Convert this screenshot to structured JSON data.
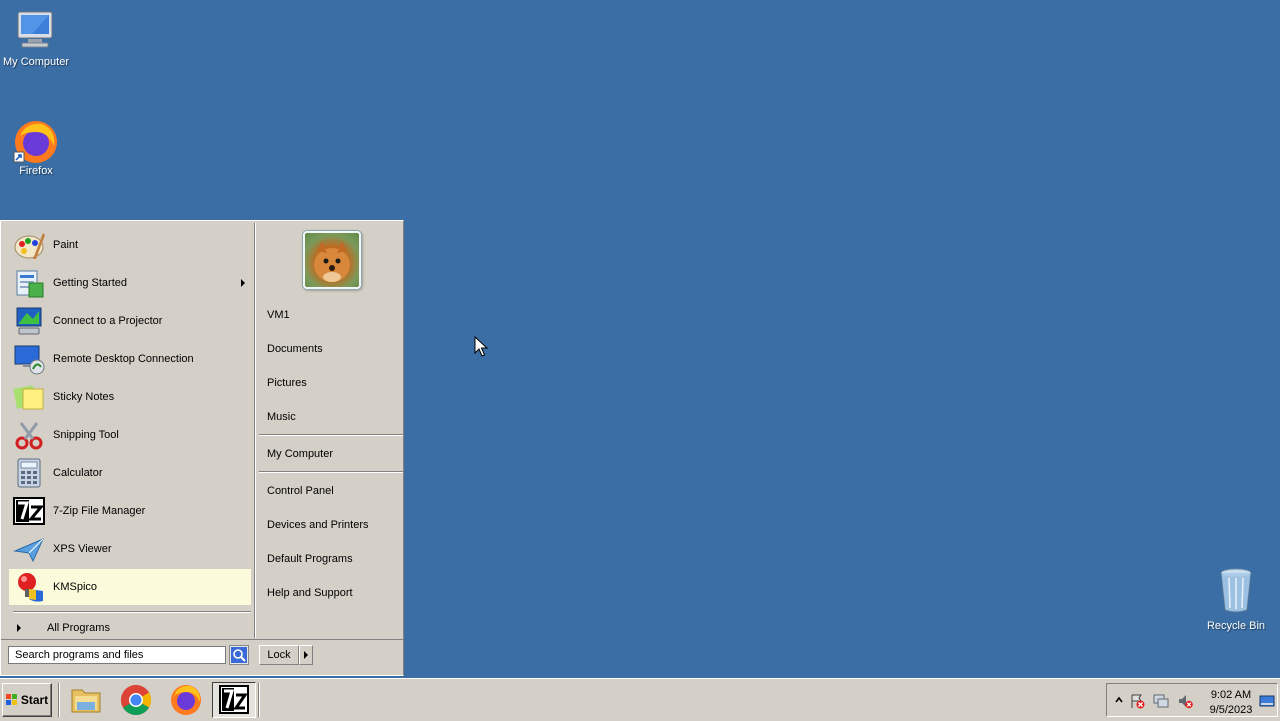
{
  "desktop": {
    "icons": [
      {
        "label": "My Computer",
        "icon": "computer-icon"
      },
      {
        "label": "Firefox",
        "icon": "firefox-icon"
      },
      {
        "label": "Recycle Bin",
        "icon": "recycle-bin-icon"
      }
    ]
  },
  "start_menu": {
    "programs": [
      {
        "label": "Paint",
        "icon": "paint-icon"
      },
      {
        "label": "Getting Started",
        "icon": "getting-started-icon",
        "has_submenu": true
      },
      {
        "label": "Connect to a Projector",
        "icon": "projector-icon"
      },
      {
        "label": "Remote Desktop Connection",
        "icon": "remote-desktop-icon"
      },
      {
        "label": "Sticky Notes",
        "icon": "sticky-notes-icon"
      },
      {
        "label": "Snipping Tool",
        "icon": "snipping-tool-icon"
      },
      {
        "label": "Calculator",
        "icon": "calculator-icon"
      },
      {
        "label": "7-Zip File Manager",
        "icon": "7zip-icon"
      },
      {
        "label": "XPS Viewer",
        "icon": "xps-viewer-icon"
      },
      {
        "label": "KMSpico",
        "icon": "kmspico-icon",
        "highlighted": true
      }
    ],
    "all_programs": "All Programs",
    "right_links": {
      "user": "VM1",
      "documents": "Documents",
      "pictures": "Pictures",
      "music": "Music",
      "my_computer": "My Computer",
      "control_panel": "Control Panel",
      "devices": "Devices and Printers",
      "default_programs": "Default Programs",
      "help": "Help and Support"
    },
    "search_placeholder": "Search programs and files",
    "lock_label": "Lock"
  },
  "taskbar": {
    "start_label": "Start",
    "pinned": [
      "explorer-icon",
      "chrome-icon",
      "firefox-icon",
      "7zip-icon"
    ],
    "clock_time": "9:02 AM",
    "clock_date": "9/5/2023"
  },
  "colors": {
    "desktop_bg": "#3a6ea5",
    "menu_bg": "#d4d0c8",
    "highlight": "#fbfbdc"
  }
}
